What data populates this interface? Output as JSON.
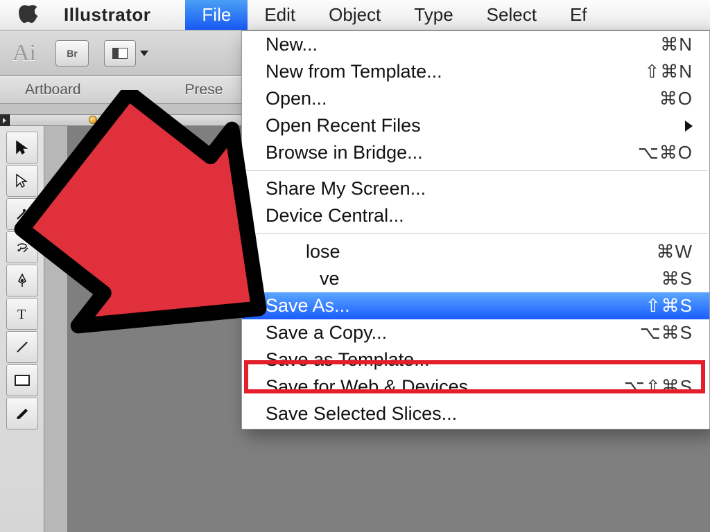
{
  "menubar": {
    "app_name": "Illustrator",
    "items": [
      "File",
      "Edit",
      "Object",
      "Type",
      "Select",
      "Ef"
    ],
    "active_index": 0
  },
  "controlbar": {
    "app_abbrev": "Ai",
    "bridge_label": "Br"
  },
  "panel_header": {
    "col1": "Artboard",
    "col2": "Prese"
  },
  "menu": {
    "groups": [
      [
        {
          "label": "New...",
          "shortcut": "⌘N"
        },
        {
          "label": "New from Template...",
          "shortcut": "⇧⌘N"
        },
        {
          "label": "Open...",
          "shortcut": "⌘O"
        },
        {
          "label": "Open Recent Files",
          "submenu": true
        },
        {
          "label": "Browse in Bridge...",
          "shortcut": "⌥⌘O"
        }
      ],
      [
        {
          "label": "Share My Screen..."
        },
        {
          "label": "Device Central..."
        }
      ],
      [
        {
          "label": "Close",
          "display_label": "lose",
          "shortcut": "⌘W"
        },
        {
          "label": "Save",
          "display_label": "ve",
          "shortcut": "⌘S"
        },
        {
          "label": "Save As...",
          "shortcut": "⇧⌘S",
          "highlight": true
        },
        {
          "label": "Save a Copy...",
          "shortcut": "⌥⌘S"
        },
        {
          "label": "Save as Template..."
        },
        {
          "label": "Save for Web & Devices...",
          "shortcut": "⌥⇧⌘S"
        },
        {
          "label": "Save Selected Slices..."
        }
      ]
    ]
  },
  "tools": [
    "selection",
    "direct-selection",
    "magic-wand",
    "lasso",
    "pen",
    "type",
    "line",
    "rectangle",
    "brush"
  ]
}
